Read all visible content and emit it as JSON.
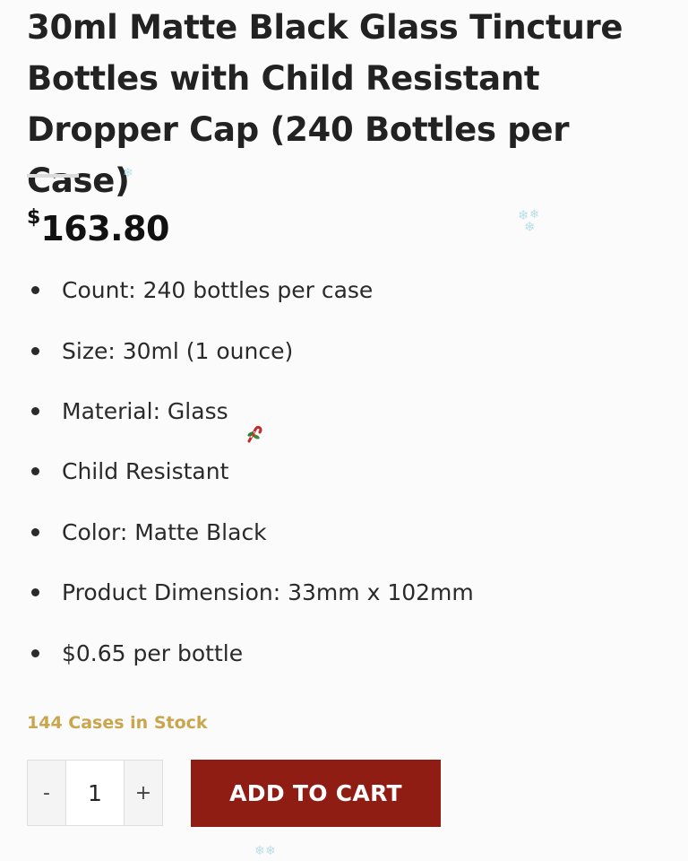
{
  "product": {
    "title": "30ml Matte Black Glass Tincture Bottles with Child Resistant Dropper Cap (240 Bottles per Case)",
    "price_currency": "$",
    "price_amount": "163.80",
    "features": [
      "Count: 240 bottles per case",
      "Size: 30ml (1 ounce)",
      "Material: Glass",
      "Child Resistant",
      "Color: Matte Black",
      "Product Dimension: 33mm x 102mm",
      "$0.65 per bottle"
    ],
    "stock": "144 Cases in Stock"
  },
  "quantity": {
    "minus_label": "-",
    "value": "1",
    "plus_label": "+"
  },
  "cart": {
    "add_label": "ADD TO CART"
  },
  "colors": {
    "add_button": "#8f1d14",
    "stock_text": "#c9a54e",
    "snowflake": "#b9dfe9"
  },
  "icons": {
    "decorations": [
      "snowflake-icon",
      "candy-cane-icon"
    ]
  }
}
